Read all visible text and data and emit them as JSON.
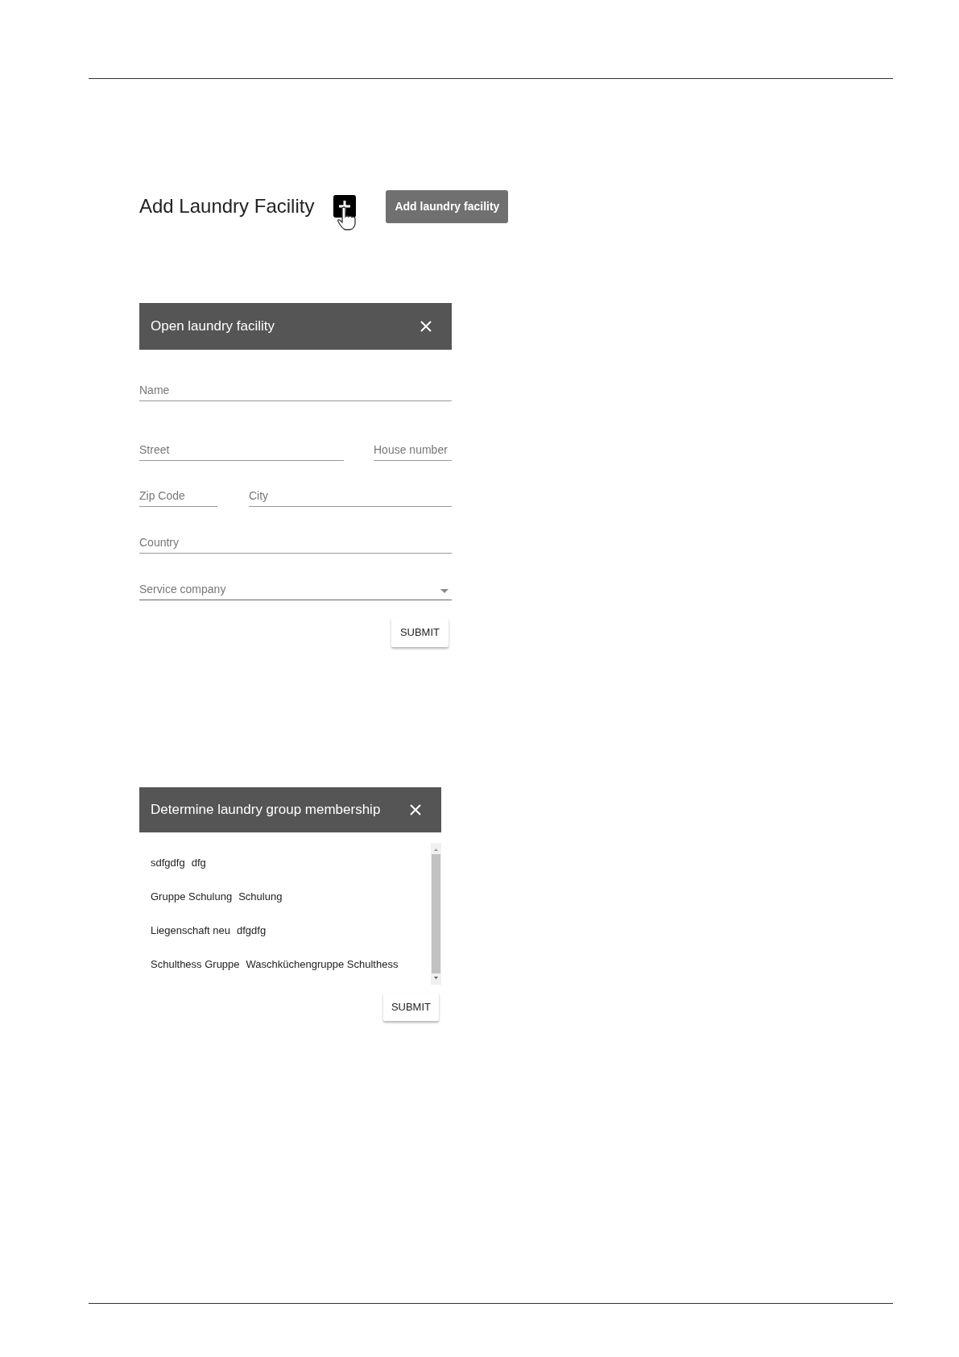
{
  "heading": {
    "title": "Add Laundry Facility",
    "tooltip": "Add laundry facility"
  },
  "facility_dialog": {
    "title": "Open laundry facility",
    "fields": [
      {
        "label": "Name",
        "kind": "text"
      },
      {
        "label": "Street",
        "kind": "text"
      },
      {
        "label": "House number",
        "kind": "text"
      },
      {
        "label": "Zip Code",
        "kind": "text"
      },
      {
        "label": "City",
        "kind": "text"
      },
      {
        "label": "Country",
        "kind": "text"
      },
      {
        "label": "Service company",
        "kind": "select"
      }
    ],
    "submit": "SUBMIT"
  },
  "group_dialog": {
    "title": "Determine laundry group membership",
    "groups": [
      {
        "name": "sdfgdfg",
        "description": "dfg"
      },
      {
        "name": "Gruppe Schulung",
        "description": "Schulung"
      },
      {
        "name": "Liegenschaft neu",
        "description": "dfgdfg"
      },
      {
        "name": "Schulthess Gruppe",
        "description": "Waschküchengruppe Schulthess"
      }
    ],
    "submit": "SUBMIT"
  }
}
